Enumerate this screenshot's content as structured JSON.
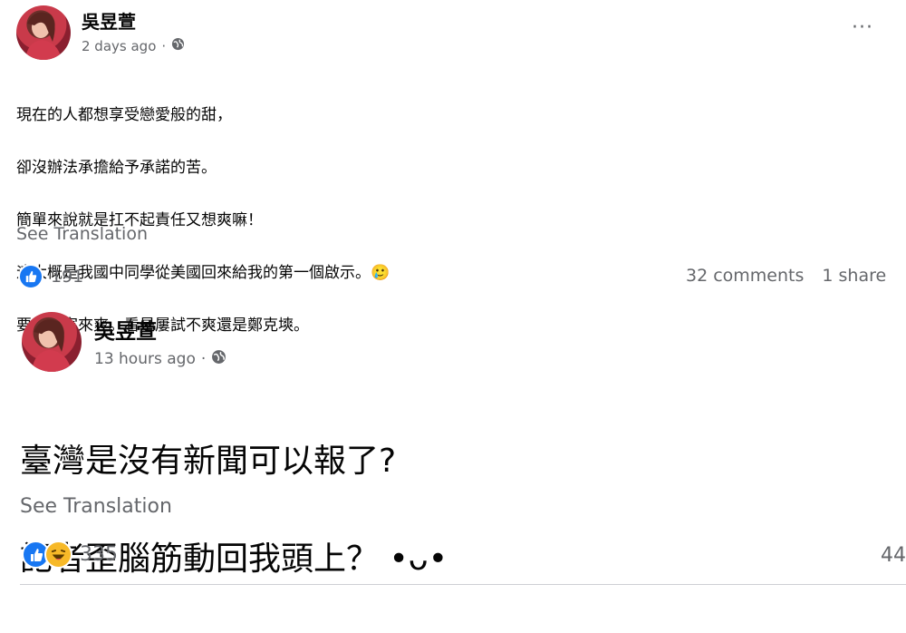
{
  "post1": {
    "author": "吳昱萱",
    "time": "2 days ago",
    "lines": [
      "現在的人都想享受戀愛般的甜，",
      "卻沒辦法承擔給予承諾的苦。",
      "簡單來說就是扛不起責任又想爽嘛！",
      "這大概是我國中同學從美國回來給我的第一個啟示。🥲",
      "要爽大家來爽。看是屢試不爽還是鄭克塽。"
    ],
    "see_translation": "See Translation",
    "reaction_count": "191",
    "comments": "32 comments",
    "shares": "1 share",
    "more": "···"
  },
  "post2": {
    "author": "吳昱萱",
    "time": "13 hours ago",
    "line1": "臺灣是沒有新聞可以報了?",
    "line2": "記者歪腦筋動回我頭上？ •ᴗ•",
    "see_translation": "See Translation",
    "reaction_count": "335",
    "comments_partial": "44"
  },
  "icons": {
    "globe": "globe-icon",
    "like": "like-reaction-icon",
    "haha": "haha-reaction-icon",
    "more": "more-options-icon"
  },
  "colors": {
    "like_blue": "#1877f2",
    "haha_yellow": "#f7b928",
    "secondary_text": "#65676b"
  }
}
